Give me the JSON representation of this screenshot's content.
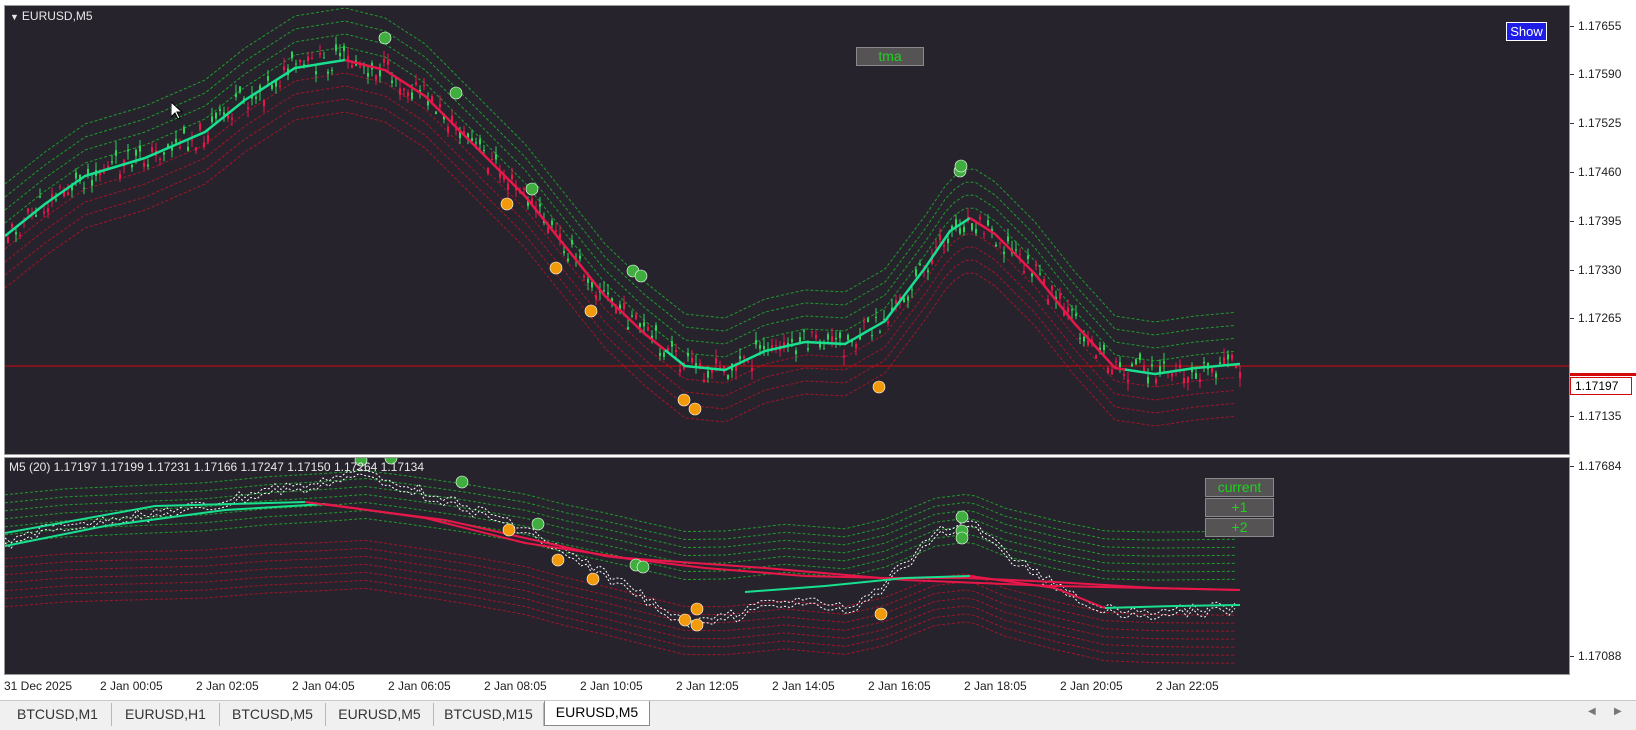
{
  "chart": {
    "symbol_title": "EURUSD,M5",
    "indicator_title": "M5  (20) 1.17197 1.17199 1.17231 1.17166 1.17247 1.17150 1.17264 1.17134",
    "show_button": "Show",
    "tma_label": "tma",
    "mode_buttons": {
      "current": "current",
      "plus1": "+1",
      "plus2": "+2"
    },
    "current_price": "1.17197",
    "colors": {
      "background": "#26232d",
      "bull_line": "#19e08f",
      "bear_line": "#e8174a",
      "upper_band": "#1f9a2a",
      "lower_band": "#a31428",
      "price_line": "#d20a0a",
      "buy_marker": "#3fae3f",
      "sell_marker": "#f29a0a"
    }
  },
  "price_axis": {
    "main_ticks": [
      "1.17655",
      "1.17590",
      "1.17525",
      "1.17460",
      "1.17395",
      "1.17330",
      "1.17265",
      "1.17197",
      "1.17135"
    ],
    "sub_ticks": [
      "1.17684",
      "1.17088"
    ]
  },
  "time_axis": [
    "31 Dec 2025",
    "2 Jan 00:05",
    "2 Jan 02:05",
    "2 Jan 04:05",
    "2 Jan 06:05",
    "2 Jan 08:05",
    "2 Jan 10:05",
    "2 Jan 12:05",
    "2 Jan 14:05",
    "2 Jan 16:05",
    "2 Jan 18:05",
    "2 Jan 20:05",
    "2 Jan 22:05"
  ],
  "tabs": [
    "BTCUSD,M1",
    "EURUSD,H1",
    "BTCUSD,M5",
    "EURUSD,M5",
    "BTCUSD,M15",
    "EURUSD,M5"
  ],
  "active_tab_index": 5,
  "icons": {
    "cursor": "arrow-cursor-icon",
    "title_marker": "triangle-down-icon",
    "scroll_left": "triangle-left-icon",
    "scroll_right": "triangle-right-icon"
  }
}
